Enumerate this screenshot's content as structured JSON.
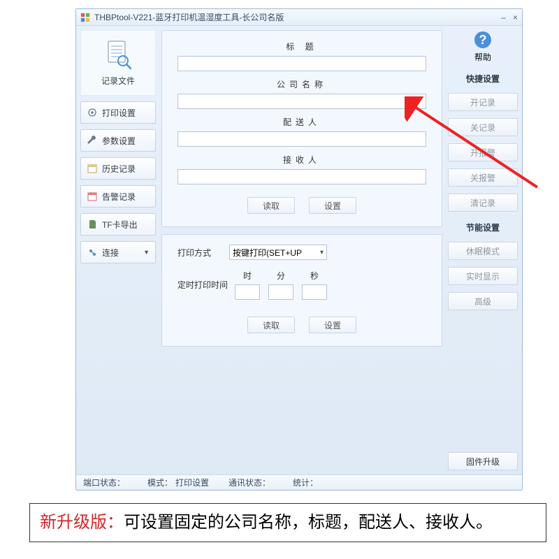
{
  "window": {
    "title": "THBPtool-V221-蓝牙打印机温湿度工具-长公司名版",
    "minimize": "–",
    "close": "×"
  },
  "left": {
    "log_file": "记录文件",
    "print_settings": "打印设置",
    "param_settings": "参数设置",
    "history": "历史记录",
    "alarm": "告警记录",
    "tf_export": "TF卡导出",
    "connect": "连接"
  },
  "form": {
    "title_label": "标 题",
    "title_value": "",
    "company_label": "公司名称",
    "company_value": "",
    "delivery_label": "配送人",
    "delivery_value": "",
    "receiver_label": "接收人",
    "receiver_value": "",
    "read_btn": "读取",
    "set_btn": "设置"
  },
  "print": {
    "mode_label": "打印方式",
    "mode_value": "按键打印(SET+UP",
    "timer_label": "定时打印时间",
    "hour": "时",
    "minute": "分",
    "second": "秒",
    "read_btn": "读取",
    "set_btn": "设置"
  },
  "right": {
    "help": "帮助",
    "quick_title": "快捷设置",
    "open_log": "开记录",
    "close_log": "关记录",
    "open_alarm": "开报警",
    "close_alarm": "关报警",
    "clear_log": "清记录",
    "energy_title": "节能设置",
    "sleep_mode": "休眠模式",
    "realtime": "实时显示",
    "advanced": "高级",
    "firmware": "固件升级"
  },
  "status": {
    "port_label": "端口状态：",
    "port_value": "",
    "mode_label": "模式：",
    "mode_value": "打印设置",
    "comm_label": "通讯状态：",
    "comm_value": "",
    "stats_label": "统计：",
    "stats_value": ""
  },
  "caption": {
    "highlight": "新升级版：",
    "rest": "可设置固定的公司名称，标题，配送人、接收人。"
  }
}
